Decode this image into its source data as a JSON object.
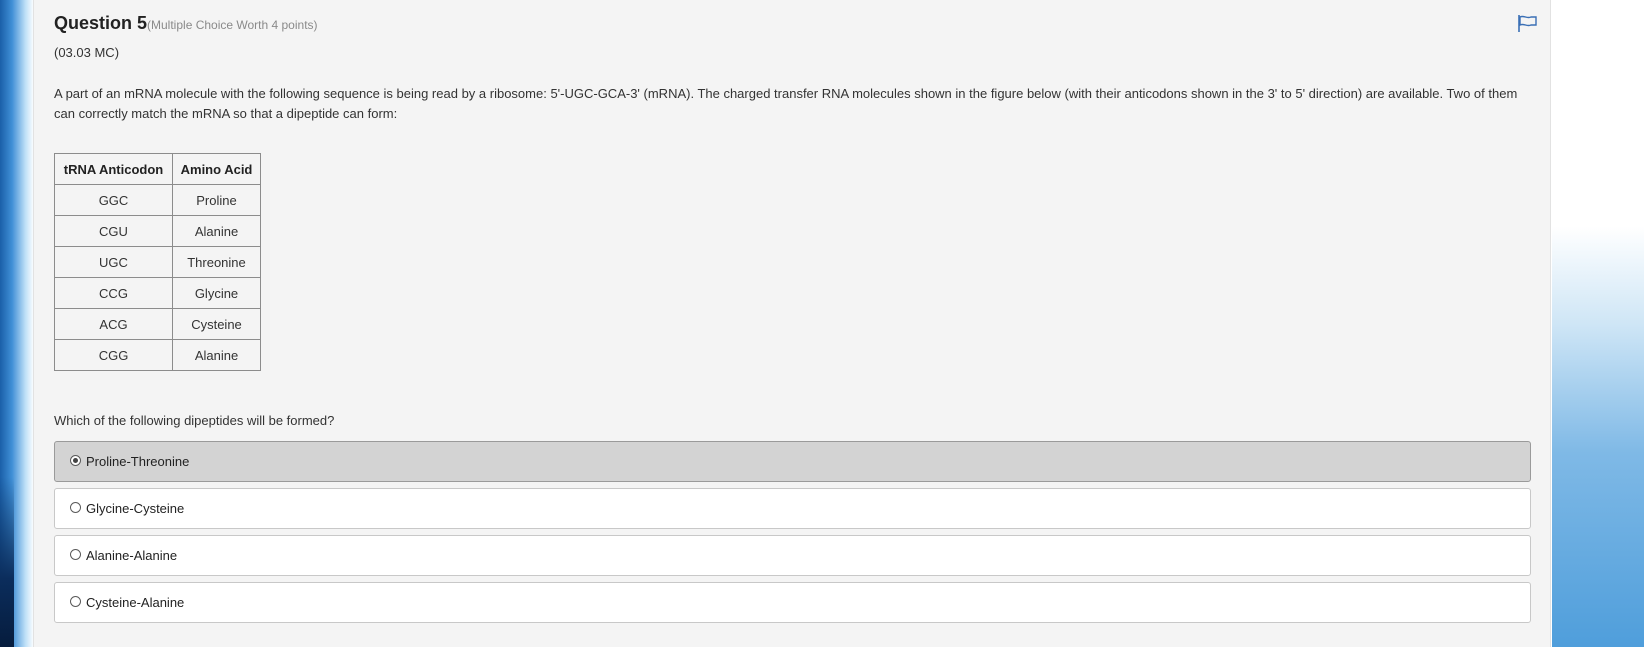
{
  "question": {
    "title": "Question 5",
    "meta": "(Multiple Choice Worth 4 points)",
    "code": "(03.03 MC)",
    "stem": "A part of an mRNA molecule with the following sequence is being read by a ribosome: 5'-UGC-GCA-3' (mRNA). The charged transfer RNA molecules shown in the figure below (with their anticodons shown in the 3' to 5' direction) are available. Two of them can correctly match the mRNA so that a dipeptide can form:",
    "prompt": "Which of the following dipeptides will be formed?"
  },
  "table": {
    "headers": [
      "tRNA Anticodon",
      "Amino Acid"
    ],
    "rows": [
      [
        "GGC",
        "Proline"
      ],
      [
        "CGU",
        "Alanine"
      ],
      [
        "UGC",
        "Threonine"
      ],
      [
        "CCG",
        "Glycine"
      ],
      [
        "ACG",
        "Cysteine"
      ],
      [
        "CGG",
        "Alanine"
      ]
    ]
  },
  "options": [
    {
      "label": "Proline-Threonine",
      "selected": true
    },
    {
      "label": "Glycine-Cysteine",
      "selected": false
    },
    {
      "label": "Alanine-Alanine",
      "selected": false
    },
    {
      "label": "Cysteine-Alanine",
      "selected": false
    }
  ],
  "icons": {
    "flag": "flag-icon"
  },
  "colors": {
    "panel": "#f4f4f4",
    "selected_option": "#d3d3d3",
    "flag": "#3a6fb5"
  }
}
